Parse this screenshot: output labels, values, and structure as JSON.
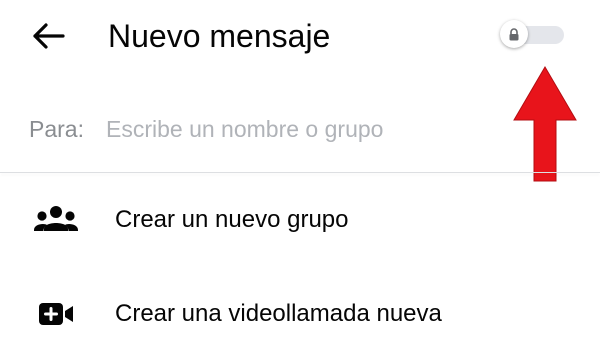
{
  "header": {
    "title": "Nuevo mensaje",
    "back_icon": "arrow-left-icon",
    "secret_toggle": {
      "icon": "lock-icon",
      "state": "off",
      "track_color": "#e4e6eb"
    }
  },
  "recipient": {
    "label": "Para:",
    "placeholder": "Escribe un nombre o grupo",
    "value": ""
  },
  "actions": [
    {
      "label": "Crear un nuevo grupo",
      "icon": "group-people-icon"
    },
    {
      "label": "Crear una videollamada nueva",
      "icon": "video-plus-icon"
    }
  ],
  "annotation": {
    "icon": "red-up-arrow-icon",
    "color": "#e8141b"
  }
}
